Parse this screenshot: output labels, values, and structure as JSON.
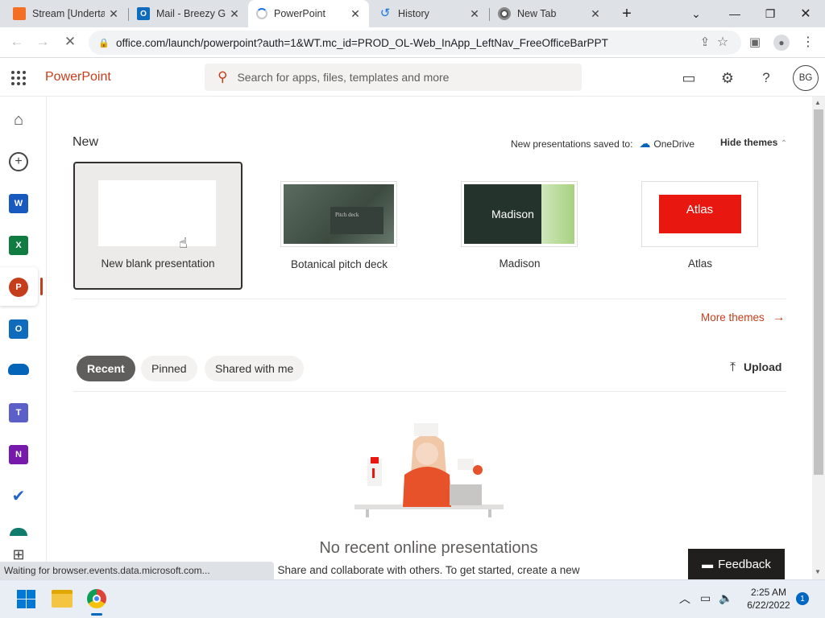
{
  "browser": {
    "tabs": [
      {
        "title": "Stream [Underta",
        "favicon": "soundcloud-icon",
        "color": "#f26f23"
      },
      {
        "title": "Mail - Breezy G",
        "favicon": "outlook-icon",
        "color": "#0f6cbd"
      },
      {
        "title": "PowerPoint",
        "favicon": "loading-spinner-icon",
        "color": "#c43e1c"
      },
      {
        "title": "History",
        "favicon": "history-icon",
        "color": "#1a73e8"
      },
      {
        "title": "New Tab",
        "favicon": "chrome-icon",
        "color": "#555555"
      }
    ],
    "new_tab_symbol": "+",
    "url": "office.com/launch/powerpoint?auth=1&WT.mc_id=PROD_OL-Web_InApp_LeftNav_FreeOfficeBarPPT"
  },
  "header": {
    "app_name": "PowerPoint",
    "search_placeholder": "Search for apps, files, templates and more",
    "avatar_initials": "BG"
  },
  "new_section": {
    "heading": "New",
    "saved_to_label": "New presentations saved to:",
    "saved_to_location": "OneDrive",
    "hide_themes": "Hide themes",
    "templates": [
      {
        "label": "New blank presentation",
        "thumb_text": ""
      },
      {
        "label": "Botanical pitch deck",
        "thumb_text": "Pitch deck"
      },
      {
        "label": "Madison",
        "thumb_text": "Madison"
      },
      {
        "label": "Atlas",
        "thumb_text": "Atlas"
      }
    ],
    "more_themes": "More themes"
  },
  "files": {
    "filters": [
      "Recent",
      "Pinned",
      "Shared with me"
    ],
    "active_filter": "Recent",
    "upload_label": "Upload",
    "empty_title": "No recent online presentations",
    "empty_subtitle": "Share and collaborate with others. To get started, create a new"
  },
  "feedback_label": "Feedback",
  "status_text": "Waiting for browser.events.data.microsoft.com...",
  "taskbar": {
    "time": "2:25 AM",
    "date": "6/22/2022",
    "notification_count": "1"
  },
  "colors": {
    "brand": "#c43e1c",
    "word": "#185abd",
    "excel": "#107c41",
    "powerpoint": "#c43e1c",
    "outlook": "#0f6cbd",
    "onedrive": "#0364b8",
    "teams": "#5b5fc7",
    "onenote": "#7719aa"
  }
}
